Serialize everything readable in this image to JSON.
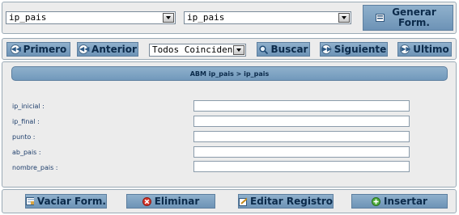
{
  "top": {
    "select_1": "ip_pais",
    "select_2": "ip_pais",
    "generate_label": "Generar Form."
  },
  "nav": {
    "first": "Primero",
    "previous": "Anterior",
    "filter_value": "Todos Coinciden",
    "search": "Buscar",
    "next": "Siguiente",
    "last": "Ultimo"
  },
  "main": {
    "header": "ABM ip_pais > ip_pais",
    "fields": [
      {
        "label": "ip_inicial :",
        "value": ""
      },
      {
        "label": "ip_final :",
        "value": ""
      },
      {
        "label": "punto :",
        "value": ""
      },
      {
        "label": "ab_pais :",
        "value": ""
      },
      {
        "label": "nombre_pais :",
        "value": ""
      }
    ]
  },
  "bottom": {
    "clear": "Vaciar Form.",
    "delete": "Eliminar",
    "edit": "Editar Registro",
    "insert": "Insertar"
  },
  "colors": {
    "button_bg": "#7fa3c4",
    "button_text": "#0b2a4a",
    "panel_bg": "#ececec",
    "label_text": "#1d3d6b"
  }
}
